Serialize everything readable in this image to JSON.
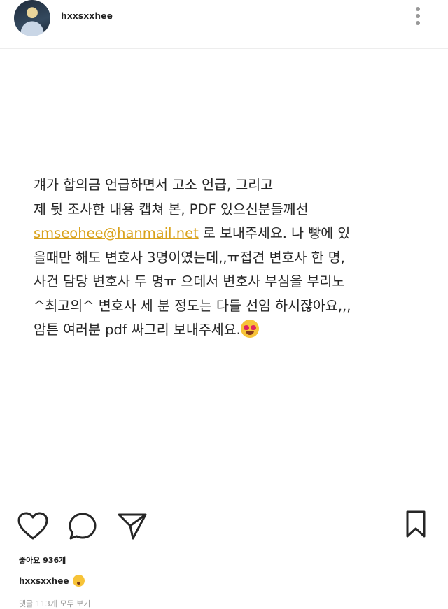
{
  "header": {
    "username": "hxxsxxhee",
    "more_icon": "more-vertical-icon"
  },
  "post": {
    "lines": [
      "걔가 합의금 언급하면서 고소 언급, 그리고",
      "제 뒷 조사한 내용 캡쳐 본, PDF 있으신분들께선",
      "smseohee@hanmail.net",
      " 로 보내주세요. 나 빵에 있",
      "을때만 해도 변호사 3명이였는데,,ㅠ접견 변호사 한 명,",
      "사건 담당 변호사 두 명ㅠ 으데서 변호사 부심을 부리노",
      "^최고의^ 변호사 세 분 정도는 다들 선임 하시잖아요,,,",
      "암튼 여러분 pdf 싸그리 보내주세요."
    ],
    "emoji": "heart-eyes-emoji"
  },
  "actions": {
    "like_icon": "heart-icon",
    "comment_icon": "comment-icon",
    "share_icon": "send-icon",
    "save_icon": "bookmark-icon"
  },
  "footer": {
    "likes": "좋아요 936개",
    "caption_user": "hxxsxxhee",
    "caption_emoji": "winking-kiss-emoji",
    "view_comments": "댓글 113개 모두 보기"
  }
}
